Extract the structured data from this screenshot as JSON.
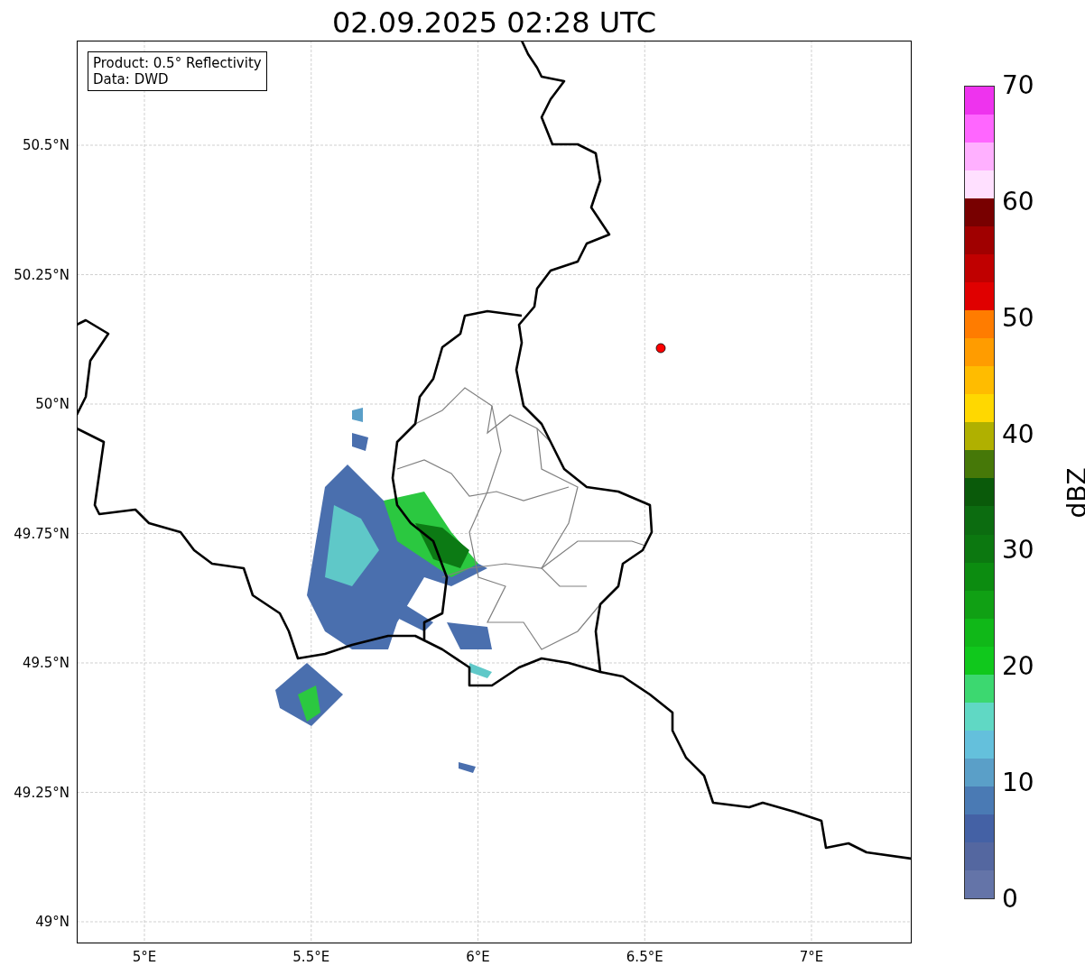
{
  "title": "02.09.2025 02:28 UTC",
  "info_box": [
    "Product: 0.5° Reflectivity",
    "Data: DWD"
  ],
  "map": {
    "lat_labels": [
      "50.5°N",
      "50.25°N",
      "50°N",
      "49.75°N",
      "49.5°N",
      "49.25°N",
      "49°N"
    ],
    "lon_labels": [
      "5°E",
      "5.5°E",
      "6°E",
      "6.5°E",
      "7°E"
    ]
  },
  "colorbar": {
    "label": "dBZ",
    "ticks": [
      "70",
      "60",
      "50",
      "40",
      "30",
      "20",
      "10",
      "0"
    ],
    "bands": [
      {
        "color": "#6474a8"
      },
      {
        "color": "#5467a0"
      },
      {
        "color": "#4461a5"
      },
      {
        "color": "#4a7ab4"
      },
      {
        "color": "#5a9fc8"
      },
      {
        "color": "#64c0dc"
      },
      {
        "color": "#60d8c4"
      },
      {
        "color": "#3cd870"
      },
      {
        "color": "#10c81c"
      },
      {
        "color": "#10b818"
      },
      {
        "color": "#10a014"
      },
      {
        "color": "#0c8c10"
      },
      {
        "color": "#0c7810"
      },
      {
        "color": "#0c6c10"
      },
      {
        "color": "#0a5a0a"
      },
      {
        "color": "#467808"
      },
      {
        "color": "#b0b000"
      },
      {
        "color": "#ffd800"
      },
      {
        "color": "#ffbc00"
      },
      {
        "color": "#ff9c00"
      },
      {
        "color": "#ff7c00"
      },
      {
        "color": "#e00000"
      },
      {
        "color": "#c00000"
      },
      {
        "color": "#a00000"
      },
      {
        "color": "#780000"
      },
      {
        "color": "#ffe0ff"
      },
      {
        "color": "#ffb0ff"
      },
      {
        "color": "#ff66ff"
      },
      {
        "color": "#ee33ee"
      }
    ]
  }
}
